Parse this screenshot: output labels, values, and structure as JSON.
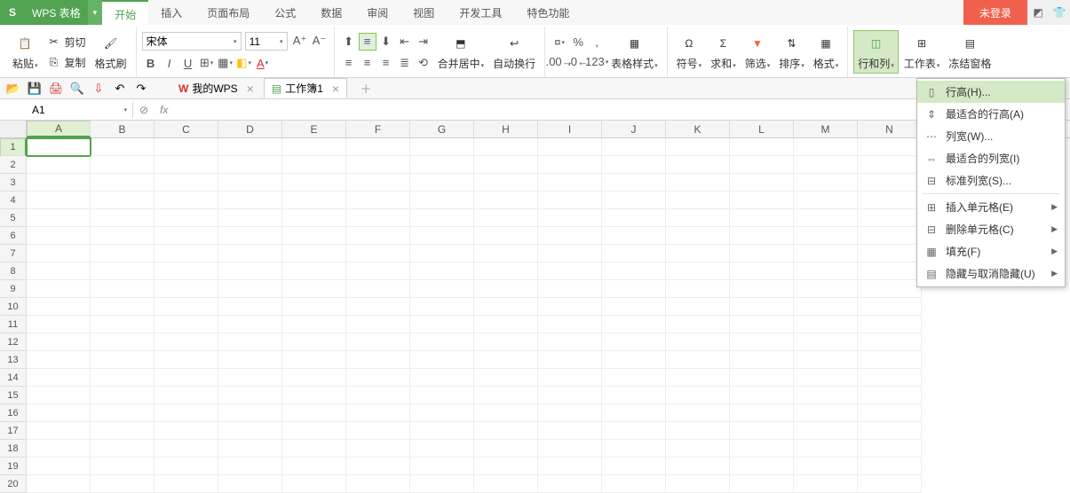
{
  "app": {
    "name": "WPS 表格",
    "login_btn": "未登录"
  },
  "menu_tabs": [
    "开始",
    "插入",
    "页面布局",
    "公式",
    "数据",
    "审阅",
    "视图",
    "开发工具",
    "特色功能"
  ],
  "active_tab": 0,
  "ribbon": {
    "paste": "粘贴",
    "cut": "剪切",
    "copy": "复制",
    "format_painter": "格式刷",
    "font_name": "宋体",
    "font_size": "11",
    "merge": "合并居中",
    "wrap": "自动换行",
    "table_style": "表格样式",
    "symbol": "符号",
    "sum": "求和",
    "filter": "筛选",
    "sort": "排序",
    "format": "格式",
    "rowcol": "行和列",
    "sheet": "工作表",
    "freeze": "冻结窗格"
  },
  "qat_tabs": [
    {
      "label": "我的WPS",
      "active": false
    },
    {
      "label": "工作簿1",
      "active": true
    }
  ],
  "name_box": "A1",
  "columns": [
    "A",
    "B",
    "C",
    "D",
    "E",
    "F",
    "G",
    "H",
    "I",
    "J",
    "K",
    "L",
    "M",
    "N"
  ],
  "rows": 20,
  "dropdown": {
    "items": [
      {
        "label": "行高(H)...",
        "hover": true
      },
      {
        "label": "最适合的行高(A)"
      },
      {
        "label": "列宽(W)..."
      },
      {
        "label": "最适合的列宽(I)"
      },
      {
        "label": "标准列宽(S)..."
      },
      {
        "sep": true
      },
      {
        "label": "插入单元格(E)",
        "sub": true
      },
      {
        "label": "删除单元格(C)",
        "sub": true
      },
      {
        "label": "填充(F)",
        "sub": true
      },
      {
        "label": "隐藏与取消隐藏(U)",
        "sub": true
      }
    ]
  }
}
